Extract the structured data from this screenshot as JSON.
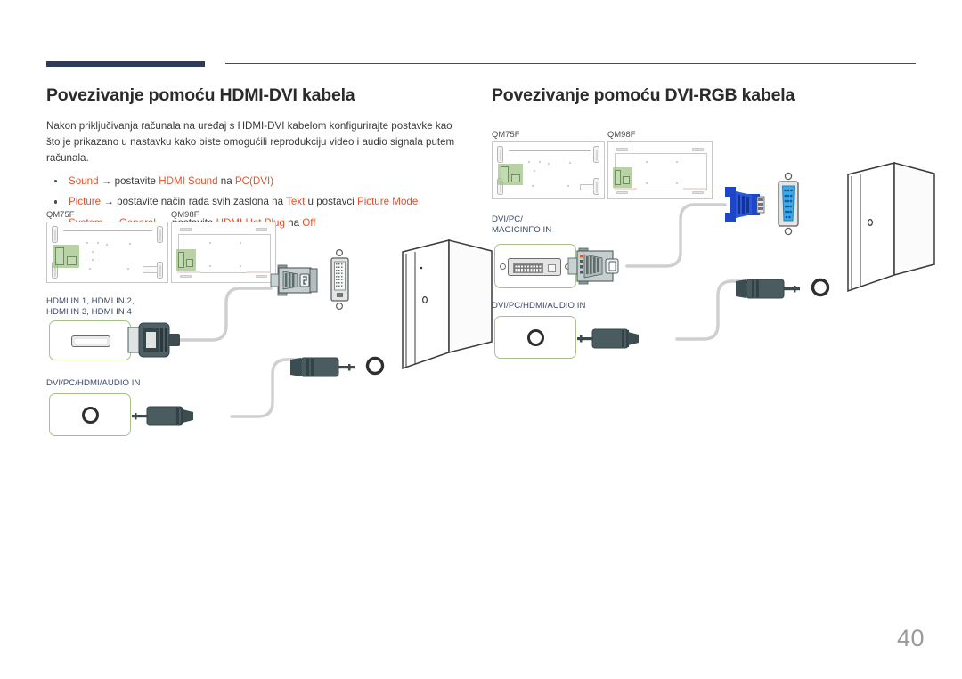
{
  "page": {
    "number": "40"
  },
  "left_section": {
    "title": "Povezivanje pomoću HDMI-DVI kabela",
    "paragraph": "Nakon priključivanja računala na uređaj s HDMI-DVI kabelom konfigurirajte postavke kao što je prikazano u nastavku kako biste omogućili reprodukciju video i audio signala putem računala.",
    "bullets": [
      {
        "parts": [
          {
            "text": "Sound",
            "highlight": true
          },
          {
            "text": " → ",
            "highlight": false
          },
          {
            "text": " postavite ",
            "highlight": false
          },
          {
            "text": "HDMI Sound",
            "highlight": true
          },
          {
            "text": " na ",
            "highlight": false
          },
          {
            "text": "PC(DVI)",
            "highlight": true
          }
        ]
      },
      {
        "parts": [
          {
            "text": "Picture",
            "highlight": true
          },
          {
            "text": " → ",
            "highlight": false
          },
          {
            "text": "postavite način rada svih zaslona na ",
            "highlight": false
          },
          {
            "text": "Text",
            "highlight": true
          },
          {
            "text": " u postavci ",
            "highlight": false
          },
          {
            "text": "Picture Mode",
            "highlight": true
          }
        ]
      },
      {
        "parts": [
          {
            "text": "System",
            "highlight": true
          },
          {
            "text": " → ",
            "highlight": false
          },
          {
            "text": "General",
            "highlight": true
          },
          {
            "text": " → ",
            "highlight": false
          },
          {
            "text": "postavite ",
            "highlight": false
          },
          {
            "text": "HDMI Hot Plug",
            "highlight": true
          },
          {
            "text": " na ",
            "highlight": false
          },
          {
            "text": "Off",
            "highlight": true
          }
        ]
      }
    ],
    "diagram": {
      "panel_labels": [
        "QM75F",
        "QM98F"
      ],
      "video_port_caption": "HDMI IN 1, HDMI IN 2,\nHDMI IN 3, HDMI IN 4",
      "audio_port_caption": "DVI/PC/HDMI/AUDIO IN"
    }
  },
  "right_section": {
    "title": "Povezivanje pomoću DVI-RGB kabela",
    "diagram": {
      "panel_labels": [
        "QM75F",
        "QM98F"
      ],
      "video_port_caption": "DVI/PC/\nMAGICINFO IN",
      "audio_port_caption": "DVI/PC/HDMI/AUDIO IN"
    }
  },
  "colors": {
    "header_bar": "#2e3a59",
    "highlight_text": "#e8512a",
    "port_caption": "#3d4a66",
    "port_box_border": "#a8c18c",
    "panel_highlight": "#9dc183",
    "cable_gray": "#cfcfcf",
    "connector_dark": "#46585c",
    "vga_blue": "#1e46c8",
    "page_number": "#9b9b9b"
  }
}
